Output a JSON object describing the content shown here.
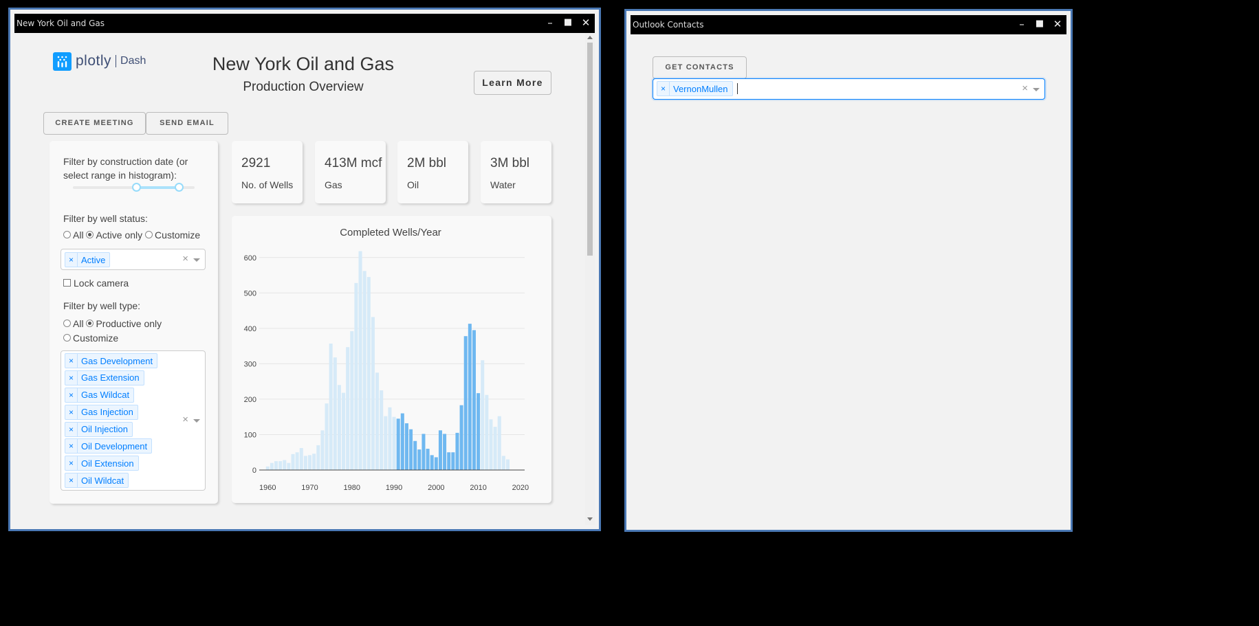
{
  "windows": {
    "left": {
      "title": "New York Oil and Gas"
    },
    "right": {
      "title": "Outlook Contacts"
    }
  },
  "titlebar_controls": {
    "minimize": "–",
    "maximize": "■",
    "close": "✕"
  },
  "header": {
    "logo_text": "plotly",
    "logo_sub": "Dash",
    "title": "New York Oil and Gas",
    "subtitle": "Production Overview",
    "learn_more": "Learn More"
  },
  "actions": {
    "create_meeting": "CREATE MEETING",
    "send_email": "SEND EMAIL"
  },
  "filters": {
    "date_label": "Filter by construction date (or select range in histogram):",
    "status_label": "Filter by well status:",
    "status_options": [
      "All",
      "Active only",
      "Customize"
    ],
    "status_selected": "Active only",
    "status_tags": [
      "Active"
    ],
    "lock_camera": "Lock camera",
    "type_label": "Filter by well type:",
    "type_options": [
      "All",
      "Productive only",
      "Customize"
    ],
    "type_selected": "Productive only",
    "type_tags": [
      "Gas Development",
      "Gas Extension",
      "Gas Wildcat",
      "Gas Injection",
      "Oil Injection",
      "Oil Development",
      "Oil Extension",
      "Oil Wildcat"
    ],
    "tag_remove": "×",
    "clear": "×"
  },
  "stats": [
    {
      "value": "2921",
      "label": "No. of Wells"
    },
    {
      "value": "413M mcf",
      "label": "Gas"
    },
    {
      "value": "2M bbl",
      "label": "Oil"
    },
    {
      "value": "3M bbl",
      "label": "Water"
    }
  ],
  "chart_data": {
    "type": "bar",
    "title": "Completed Wells/Year",
    "xlabel": "",
    "ylabel": "",
    "ylim": [
      0,
      650
    ],
    "xlim": [
      1958,
      2021
    ],
    "yticks": [
      0,
      100,
      200,
      300,
      400,
      500,
      600
    ],
    "xticks": [
      1960,
      1970,
      1980,
      1990,
      2000,
      2010,
      2020
    ],
    "grid": true,
    "selected_range": [
      1991,
      2010
    ],
    "colors": {
      "selected": "#6fb8f0",
      "unselected": "#d6eaf8"
    },
    "x": [
      1960,
      1961,
      1962,
      1963,
      1964,
      1965,
      1966,
      1967,
      1968,
      1969,
      1970,
      1971,
      1972,
      1973,
      1974,
      1975,
      1976,
      1977,
      1978,
      1979,
      1980,
      1981,
      1982,
      1983,
      1984,
      1985,
      1986,
      1987,
      1988,
      1989,
      1990,
      1991,
      1992,
      1993,
      1994,
      1995,
      1996,
      1997,
      1998,
      1999,
      2000,
      2001,
      2002,
      2003,
      2004,
      2005,
      2006,
      2007,
      2008,
      2009,
      2010,
      2011,
      2012,
      2013,
      2014,
      2015,
      2016,
      2017
    ],
    "values": [
      10,
      20,
      25,
      25,
      28,
      20,
      45,
      50,
      62,
      40,
      42,
      46,
      70,
      112,
      188,
      357,
      318,
      240,
      218,
      347,
      392,
      528,
      618,
      562,
      545,
      432,
      275,
      225,
      152,
      177,
      150,
      145,
      160,
      132,
      115,
      82,
      58,
      102,
      60,
      42,
      36,
      112,
      102,
      50,
      50,
      105,
      183,
      378,
      413,
      395,
      217,
      310,
      212,
      143,
      122,
      152,
      40,
      30
    ]
  },
  "contacts": {
    "get_contacts": "GET CONTACTS",
    "selected": [
      "VernonMullen"
    ]
  }
}
